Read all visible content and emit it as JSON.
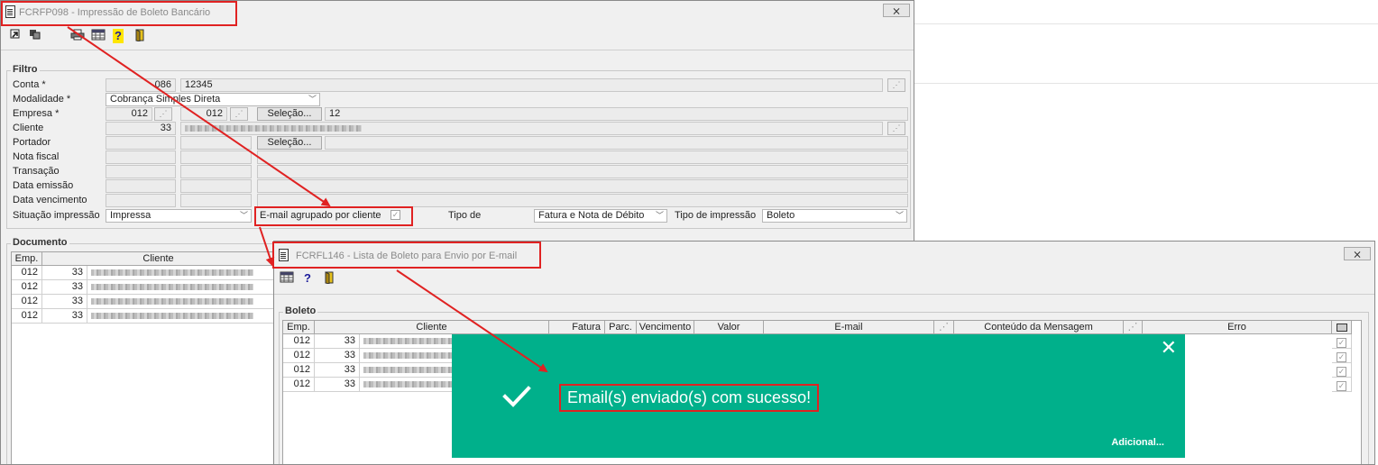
{
  "main_window": {
    "title": "FCRFP098 - Impressão de Boleto Bancário",
    "close": "⨯",
    "toolbar": [
      "confirm-icon",
      "cancel-icon",
      "print-icon",
      "grid-icon",
      "help-icon",
      "exit-icon"
    ]
  },
  "filtro": {
    "title": "Filtro",
    "conta": {
      "label": "Conta *",
      "code": "086",
      "value": "12345"
    },
    "modalidade": {
      "label": "Modalidade *",
      "value": "Cobrança Simples Direta"
    },
    "empresa": {
      "label": "Empresa *",
      "from": "012",
      "to": "012",
      "button": "Seleção...",
      "value": "12"
    },
    "cliente": {
      "label": "Cliente",
      "code": "33"
    },
    "portador": {
      "label": "Portador",
      "button": "Seleção..."
    },
    "nota_fiscal": {
      "label": "Nota fiscal"
    },
    "transacao": {
      "label": "Transação"
    },
    "data_emissao": {
      "label": "Data emissão"
    },
    "data_vencimento": {
      "label": "Data vencimento"
    },
    "situacao": {
      "label": "Situação impressão",
      "value": "Impressa"
    },
    "email_agrupado": {
      "label": "E-mail agrupado por cliente",
      "checked": true
    },
    "tipo_de": {
      "label": "Tipo de",
      "value": "Fatura e Nota de Débito"
    },
    "tipo_impressao": {
      "label": "Tipo de impressão",
      "value": "Boleto"
    }
  },
  "documento": {
    "title": "Documento",
    "columns": [
      "Emp.",
      "Cliente"
    ],
    "rows": [
      {
        "emp": "012",
        "cliente_code": "33"
      },
      {
        "emp": "012",
        "cliente_code": "33"
      },
      {
        "emp": "012",
        "cliente_code": "33"
      },
      {
        "emp": "012",
        "cliente_code": "33"
      }
    ]
  },
  "email_window": {
    "title": "FCRFL146 - Lista de Boleto para Envio por E-mail",
    "close": "⨯",
    "toolbar": [
      "grid-icon",
      "help-icon",
      "exit-icon"
    ],
    "boleto": {
      "title": "Boleto",
      "columns": [
        "Emp.",
        "Cliente",
        "Fatura",
        "Parc.",
        "Vencimento",
        "Valor",
        "E-mail",
        "Conteúdo da Mensagem",
        "Erro"
      ],
      "rows": [
        {
          "emp": "012",
          "cliente_code": "33"
        },
        {
          "emp": "012",
          "cliente_code": "33"
        },
        {
          "emp": "012",
          "cliente_code": "33"
        },
        {
          "emp": "012",
          "cliente_code": "33"
        }
      ]
    }
  },
  "toast": {
    "message": "Email(s) enviado(s) com sucesso!",
    "link": "Adicional...",
    "close": "✕",
    "background": "#00b08b"
  },
  "colors": {
    "highlight": "#e02222",
    "toast": "#00b08b",
    "title_text": "#8a8a8a"
  }
}
